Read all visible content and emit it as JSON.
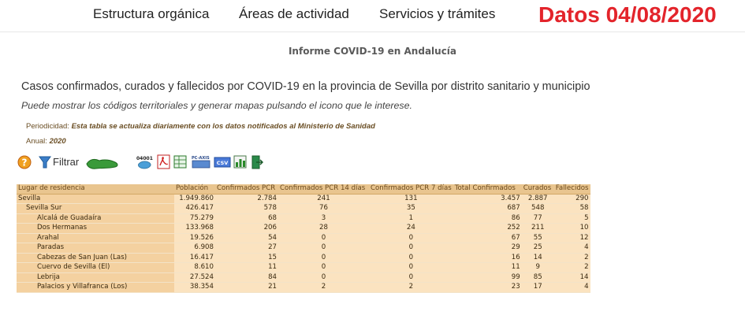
{
  "nav": {
    "items": [
      "Estructura orgánica",
      "Áreas de actividad",
      "Servicios y trámites"
    ],
    "date_banner": "Datos 04/08/2020"
  },
  "report": {
    "title": "Informe COVID-19 en Andalucía",
    "heading": "Casos confirmados, curados y fallecidos por COVID-19 en la provincia de Sevilla por distrito sanitario y municipio",
    "subheading": "Puede mostrar los códigos territoriales y generar mapas pulsando el icono que le interese.",
    "periodicidad_label": "Periodicidad:",
    "periodicidad_value": "Esta tabla se actualiza diariamente con los datos notificados al Ministerio de Sanidad",
    "anual_label": "Anual:",
    "anual_value": "2020"
  },
  "toolbar": {
    "filter_label": "Filtrar",
    "icons": [
      "help-icon",
      "filter-icon",
      "map-icon",
      "territorial-code-icon",
      "pdf-icon",
      "spreadsheet-icon",
      "pc-axis-icon",
      "csv-icon",
      "chart-icon",
      "exit-icon"
    ],
    "code_text": "04001",
    "pcaxis_text": "PC-AXIS",
    "csv_text": "CSV"
  },
  "table": {
    "columns": [
      "Lugar de residencia",
      "Población",
      "Confirmados PCR",
      "Confirmados PCR 14 días",
      "Confirmados PCR 7 días",
      "Total Confirmados",
      "Curados",
      "Fallecidos"
    ],
    "rows": [
      {
        "level": 0,
        "cells": [
          "Sevilla",
          "1.949.860",
          "2.784",
          "241",
          "131",
          "3.457",
          "2.887",
          "290"
        ]
      },
      {
        "level": 1,
        "cells": [
          "Sevilla Sur",
          "426.417",
          "578",
          "76",
          "35",
          "687",
          "548",
          "58"
        ]
      },
      {
        "level": 2,
        "cells": [
          "Alcalá de Guadaíra",
          "75.279",
          "68",
          "3",
          "1",
          "86",
          "77",
          "5"
        ]
      },
      {
        "level": 2,
        "cells": [
          "Dos Hermanas",
          "133.968",
          "206",
          "28",
          "24",
          "252",
          "211",
          "10"
        ]
      },
      {
        "level": 2,
        "cells": [
          "Arahal",
          "19.526",
          "54",
          "0",
          "0",
          "67",
          "55",
          "12"
        ]
      },
      {
        "level": 2,
        "cells": [
          "Paradas",
          "6.908",
          "27",
          "0",
          "0",
          "29",
          "25",
          "4"
        ]
      },
      {
        "level": 2,
        "cells": [
          "Cabezas de San Juan (Las)",
          "16.417",
          "15",
          "0",
          "0",
          "16",
          "14",
          "2"
        ]
      },
      {
        "level": 2,
        "cells": [
          "Cuervo de Sevilla (El)",
          "8.610",
          "11",
          "0",
          "0",
          "11",
          "9",
          "2"
        ]
      },
      {
        "level": 2,
        "cells": [
          "Lebrija",
          "27.524",
          "84",
          "0",
          "0",
          "99",
          "85",
          "14"
        ]
      },
      {
        "level": 2,
        "cells": [
          "Palacios y Villafranca (Los)",
          "38.354",
          "21",
          "2",
          "2",
          "23",
          "17",
          "4"
        ]
      }
    ]
  },
  "colors": {
    "banner_red": "#e3242b",
    "header_bg": "#e9c58f",
    "row_bg": "#fbe3c0",
    "name_col_bg": "#f4d1a0"
  }
}
